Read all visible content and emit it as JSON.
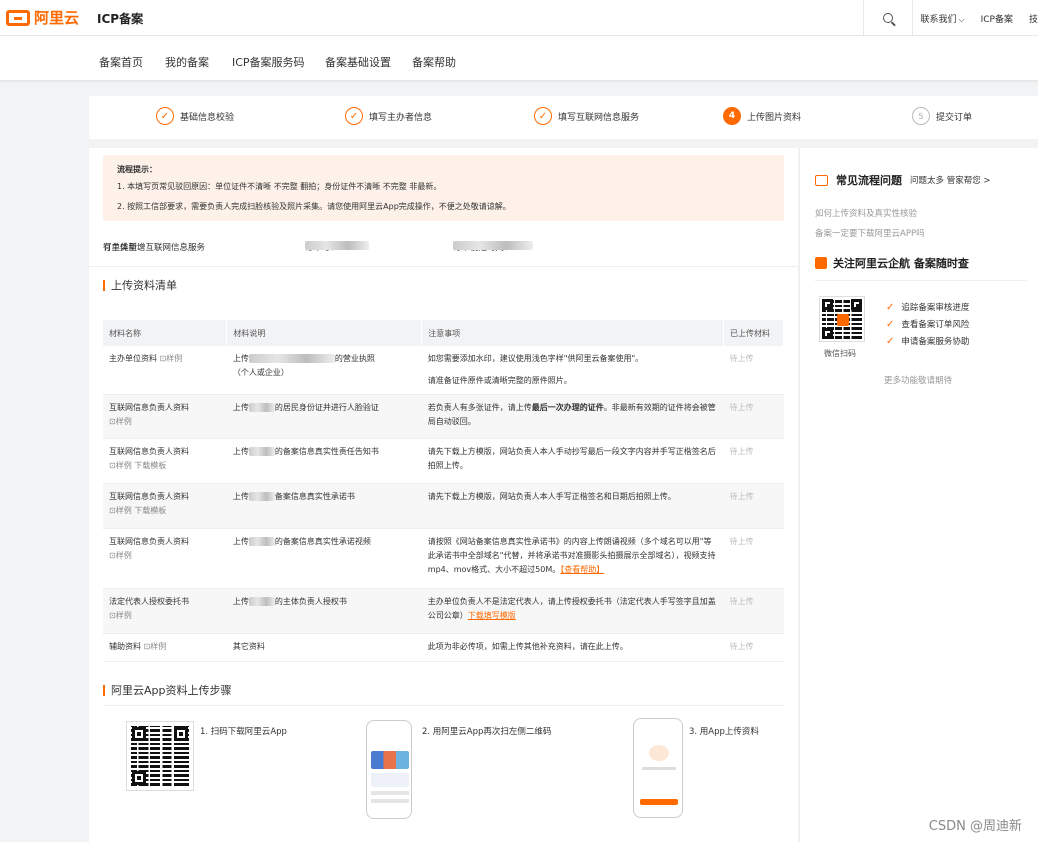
{
  "header": {
    "logo_text": "阿里云",
    "title": "ICP备案",
    "links": [
      "联系我们",
      "ICP备案",
      "技"
    ]
  },
  "nav": [
    "备案首页",
    "我的备案",
    "ICP备案服务码",
    "备案基础设置",
    "备案帮助"
  ],
  "steps": [
    {
      "label": "基础信息校验",
      "state": "done",
      "mark": "✓"
    },
    {
      "label": "填写主办者信息",
      "state": "done",
      "mark": "✓"
    },
    {
      "label": "填写互联网信息服务",
      "state": "done",
      "mark": "✓"
    },
    {
      "label": "上传图片资料",
      "state": "active",
      "mark": "4"
    },
    {
      "label": "提交订单",
      "state": "todo",
      "mark": "5"
    }
  ],
  "notice": {
    "title": "流程提示：",
    "line1": "1. 本填写页常见驳回原因：单位证件不清晰 不完整 翻拍；身份证件不清晰 不完整 非最新。",
    "line2": "2. 按照工信部要求，需要负责人完成扫脸核验及照片采集。请您使用阿里云App完成操作，不便之处敬请谅解。"
  },
  "order": {
    "type_label": "订单类型：",
    "type_value": "有主体新增互联网信息服务",
    "no_label": "订单号：",
    "time_label": "订单创建时间："
  },
  "upload_list": {
    "title": "上传资料清单",
    "headers": [
      "材料名称",
      "材料说明",
      "注意事项",
      "已上传材料"
    ],
    "sample": "样例",
    "template": "下载模板",
    "pending": "待上传",
    "rows": [
      {
        "name": "主办单位资料",
        "desc_a": "上传",
        "desc_b": "的营业执照",
        "desc_c": "（个人或企业）",
        "note1": "如您需要添加水印，建议使用浅色字样\"供阿里云备案使用\"。",
        "note2": "请准备证件原件或清晰完整的原件照片。"
      },
      {
        "name": "互联网信息负责人资料",
        "desc_a": "上传",
        "desc_b": "的居民身份证并进行人脸验证",
        "note_a": "若负责人有多张证件，请上传",
        "note_em": "最后一次办理的证件",
        "note_b": "。非最新有效期的证件将会被管局自动驳回。"
      },
      {
        "name": "互联网信息负责人资料",
        "desc_a": "上传",
        "desc_b": "的备案信息真实性责任告知书",
        "note": "请先下载上方模版，网站负责人本人手动抄写最后一段文字内容并手写正楷签名后拍照上传。"
      },
      {
        "name": "互联网信息负责人资料",
        "desc_a": "上传",
        "desc_b": "备案信息真实性承诺书",
        "note": "请先下载上方模版，网站负责人本人手写正楷签名和日期后拍照上传。"
      },
      {
        "name": "互联网信息负责人资料",
        "desc_a": "上传",
        "desc_b": "的备案信息真实性承诺视频",
        "note": "请按照《网站备案信息真实性承诺书》的内容上传朗诵视频（多个域名可以用\"等此承诺书中全部域名\"代替，并将承诺书对准摄影头拍摄展示全部域名），视频支持mp4、mov格式、大小不超过50M。",
        "note_link": "【查看帮助】"
      },
      {
        "name": "法定代表人授权委托书",
        "desc_a": "上传",
        "desc_b": "的主体负责人授权书",
        "note": "主办单位负责人不是法定代表人，请上传授权委托书（法定代表人手写签字且加盖公司公章）",
        "note_link": "下载填写模版"
      },
      {
        "name": "辅助资料",
        "desc": "其它资料",
        "note": "此项为非必传项，如需上传其他补充资料，请在此上传。"
      }
    ]
  },
  "app_steps": {
    "title": "阿里云App资料上传步骤",
    "items": [
      "1. 扫码下载阿里云App",
      "2. 用阿里云App再次扫左侧二维码",
      "3. 用App上传资料"
    ]
  },
  "side": {
    "faq_title": "常见流程问题",
    "faq_extra": "问题太多 管家帮您 >",
    "faq_items": [
      "如何上传资料及真实性核验",
      "备案一定要下载阿里云APP吗"
    ],
    "follow_title": "关注阿里云企航 备案随时查",
    "wechat_label": "微信扫码",
    "features": [
      "追踪备案审核进度",
      "查看备案订单风险",
      "申请备案服务协助"
    ],
    "more": "更多功能敬请期待"
  },
  "watermark": "CSDN @周迪新",
  "colors": {
    "accent": "#ff6a00",
    "notice_bg": "#fdf1ea"
  }
}
